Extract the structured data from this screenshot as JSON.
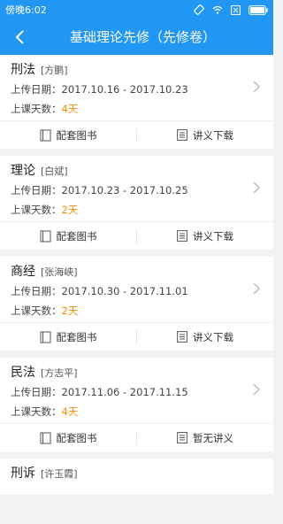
{
  "status_bar": {
    "time": "傍晚6:02",
    "icons": [
      "rotate-icon",
      "wifi-icon",
      "sim-x-icon",
      "battery-icon"
    ]
  },
  "header": {
    "title": "基础理论先修（先修卷）",
    "back_icon": "back-arrow-icon",
    "color": "#2196f3"
  },
  "labels": {
    "upload_date": "上传日期：",
    "class_days": "上课天数：",
    "days_highlight_color": "#ff8c00"
  },
  "courses": [
    {
      "subject": "刑法",
      "teacher": "[方鹏]",
      "dates": "2017.10.16 - 2017.10.23",
      "days": "4天",
      "action_left": "配套图书",
      "action_right": "讲义下载"
    },
    {
      "subject": "理论",
      "teacher": "[白斌]",
      "dates": "2017.10.23 - 2017.10.25",
      "days": "2天",
      "action_left": "配套图书",
      "action_right": "讲义下载"
    },
    {
      "subject": "商经",
      "teacher": "[张海峡]",
      "dates": "2017.10.30 - 2017.11.01",
      "days": "2天",
      "action_left": "配套图书",
      "action_right": "讲义下载"
    },
    {
      "subject": "民法",
      "teacher": "[方志平]",
      "dates": "2017.11.06 - 2017.11.15",
      "days": "4天",
      "action_left": "配套图书",
      "action_right": "暂无讲义"
    },
    {
      "subject": "刑诉",
      "teacher": "[许玉霞]"
    }
  ]
}
